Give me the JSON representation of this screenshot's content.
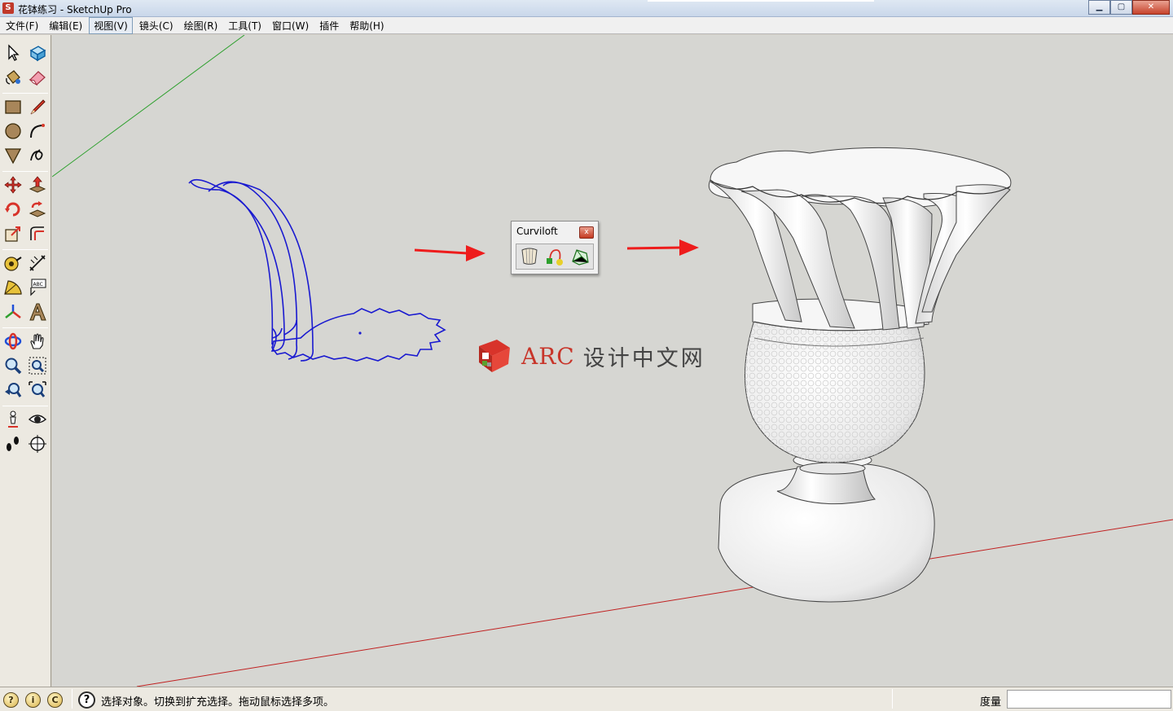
{
  "window": {
    "app_icon": "sketchup-icon",
    "title": "花钵练习 - SketchUp Pro",
    "buttons": {
      "minimize": "▁",
      "maximize": "▢",
      "close": "✕"
    }
  },
  "menu": {
    "items": [
      {
        "label": "文件(F)"
      },
      {
        "label": "编辑(E)"
      },
      {
        "label": "视图(V)"
      },
      {
        "label": "镜头(C)"
      },
      {
        "label": "绘图(R)"
      },
      {
        "label": "工具(T)"
      },
      {
        "label": "窗口(W)"
      },
      {
        "label": "插件"
      },
      {
        "label": "帮助(H)"
      }
    ]
  },
  "toolbar": {
    "tools": [
      "select-tool-icon",
      "component-tool-icon",
      "paint-bucket-icon",
      "eraser-icon",
      "rectangle-icon",
      "line-icon",
      "circle-icon",
      "arc-icon",
      "polygon-icon",
      "freehand-icon",
      "move-icon",
      "push-pull-icon",
      "rotate-icon",
      "follow-me-icon",
      "scale-icon",
      "offset-icon",
      "tape-measure-icon",
      "dimension-icon",
      "protractor-icon",
      "text-icon",
      "axes-icon",
      "3d-text-icon",
      "orbit-icon",
      "pan-icon",
      "zoom-icon",
      "zoom-window-icon",
      "previous-view-icon",
      "zoom-extents-icon",
      "position-camera-icon",
      "look-around-icon",
      "walk-icon",
      "section-plane-icon"
    ],
    "dimension_icon_text": "ABC"
  },
  "curviloft": {
    "title": "Curviloft",
    "close": "x",
    "tools": [
      "loft-by-spline-icon",
      "skin-contours-icon",
      "loft-along-path-icon"
    ]
  },
  "watermark": {
    "latin": "ARC",
    "chinese": "设计中文网"
  },
  "statusbar": {
    "icons": [
      "geo-location-icon",
      "credits-icon",
      "user-account-icon"
    ],
    "help_glyph": "?",
    "message": "选择对象。切换到扩充选择。拖动鼠标选择多项。",
    "measure_label": "度量",
    "measure_value": ""
  },
  "colors": {
    "profile_lines": "#1a1ad0",
    "arrows": "#ee1c1c",
    "green_axis": "#2ea02e",
    "red_axis": "#c02020",
    "viewport_bg": "#d6d6d2"
  }
}
